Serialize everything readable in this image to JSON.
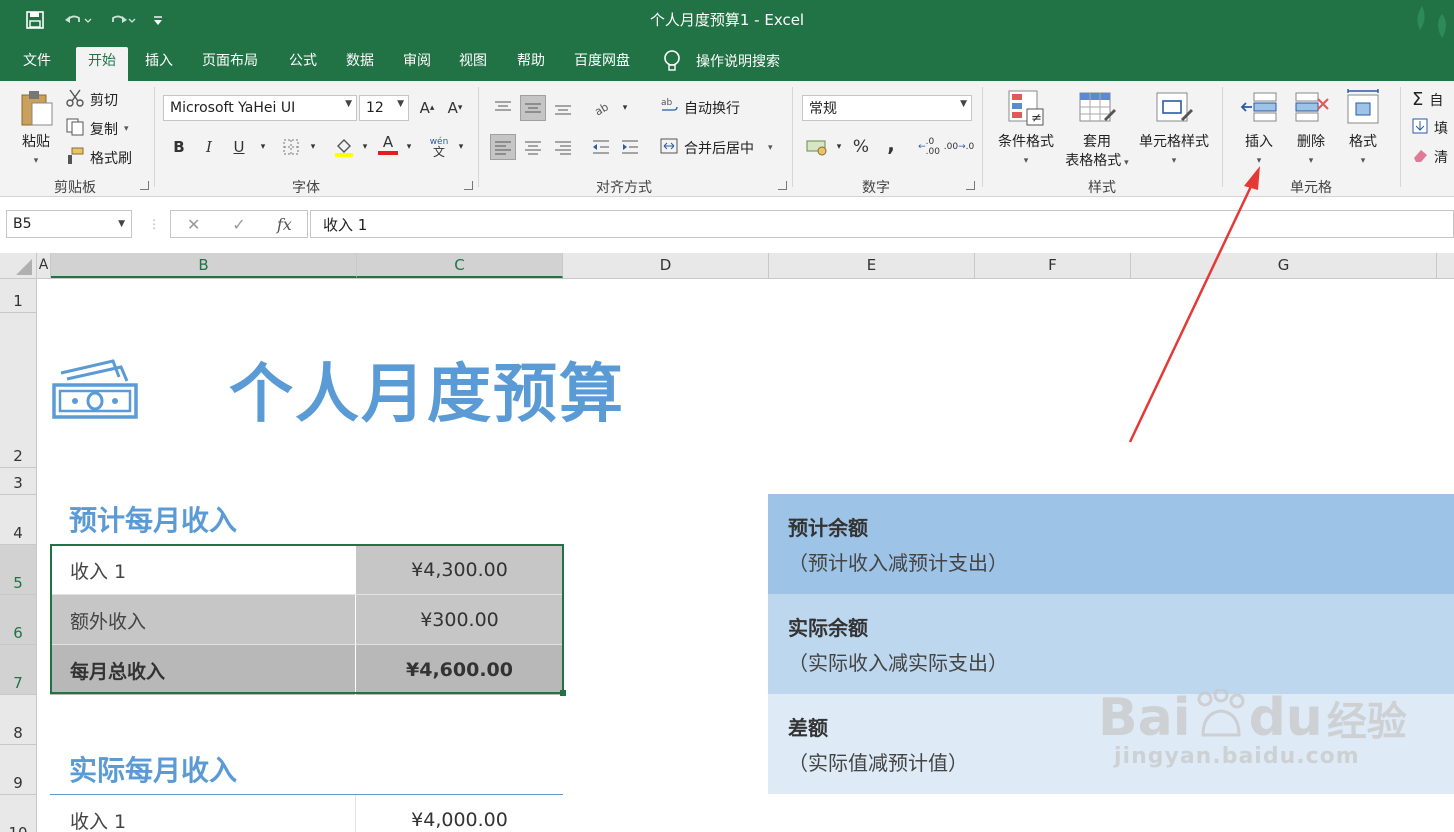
{
  "window": {
    "title": "个人月度预算1  -  Excel"
  },
  "quick_access": {
    "save": "save-icon",
    "undo": "undo-icon",
    "redo": "redo-icon",
    "customize": "customize-icon"
  },
  "tabs": [
    {
      "label": "文件"
    },
    {
      "label": "开始"
    },
    {
      "label": "插入"
    },
    {
      "label": "页面布局"
    },
    {
      "label": "公式"
    },
    {
      "label": "数据"
    },
    {
      "label": "审阅"
    },
    {
      "label": "视图"
    },
    {
      "label": "帮助"
    },
    {
      "label": "百度网盘"
    }
  ],
  "tell_me": "操作说明搜索",
  "ribbon": {
    "clipboard": {
      "paste": "粘贴",
      "cut": "剪切",
      "copy": "复制",
      "format_painter": "格式刷",
      "label": "剪贴板"
    },
    "font": {
      "name": "Microsoft YaHei UI",
      "size": "12",
      "bold": "B",
      "italic": "I",
      "underline": "U",
      "font_color_letter": "A",
      "phonetic": "wén",
      "label": "字体"
    },
    "alignment": {
      "wrap": "自动换行",
      "merge": "合并后居中",
      "label": "对齐方式"
    },
    "number": {
      "format": "常规",
      "percent": "%",
      "comma": ",",
      "label": "数字"
    },
    "styles": {
      "conditional": "条件格式",
      "table_line1": "套用",
      "table_line2": "表格格式",
      "cell_styles": "单元格样式",
      "label": "样式"
    },
    "cells": {
      "insert": "插入",
      "delete": "删除",
      "format": "格式",
      "label": "单元格"
    },
    "editing": {
      "autosum": "自",
      "fill": "填",
      "clear": "清"
    }
  },
  "formula_bar": {
    "name_box": "B5",
    "cancel": "✕",
    "enter": "✓",
    "fx": "fx",
    "content": "收入 1"
  },
  "columns": [
    "A",
    "B",
    "C",
    "D",
    "E",
    "F",
    "G"
  ],
  "rows": [
    "1",
    "2",
    "3",
    "4",
    "5",
    "6",
    "7",
    "8",
    "9",
    "10"
  ],
  "sheet": {
    "title": "个人月度预算",
    "projected_income": {
      "heading": "预计每月收入",
      "rows": [
        {
          "label": "收入 1",
          "value": "¥4,300.00"
        },
        {
          "label": "额外收入",
          "value": "¥300.00"
        },
        {
          "label": "每月总收入",
          "value": "¥4,600.00"
        }
      ]
    },
    "actual_income": {
      "heading": "实际每月收入",
      "rows": [
        {
          "label": "收入 1",
          "value": "¥4,000.00"
        }
      ]
    },
    "summary": [
      {
        "title": "预计余额",
        "subtitle": "（预计收入减预计支出）",
        "color": "#9dc3e6"
      },
      {
        "title": "实际余额",
        "subtitle": "（实际收入减实际支出）",
        "color": "#bdd7ee"
      },
      {
        "title": "差额",
        "subtitle": "（实际值减预计值）",
        "color": "#deebf7"
      }
    ]
  },
  "watermark": {
    "text": "Bai",
    "text2": "du",
    "text3": "经验",
    "url": "jingyan.baidu.com"
  },
  "colors": {
    "excel_green": "#217346",
    "title_blue": "#5b9bd5",
    "selection_gray": "#c8c8c8",
    "arrow_red": "#e53935"
  }
}
